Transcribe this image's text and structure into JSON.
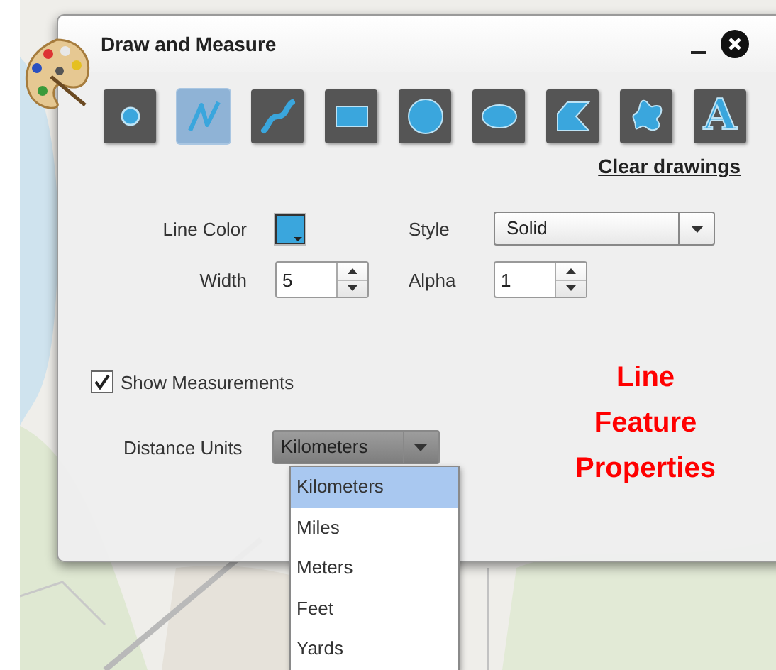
{
  "window": {
    "title": "Draw and Measure"
  },
  "tools": [
    {
      "kind": "point",
      "selected": false
    },
    {
      "kind": "polyline",
      "selected": true
    },
    {
      "kind": "freehand-line",
      "selected": false
    },
    {
      "kind": "rectangle",
      "selected": false
    },
    {
      "kind": "circle",
      "selected": false
    },
    {
      "kind": "ellipse",
      "selected": false
    },
    {
      "kind": "polygon",
      "selected": false
    },
    {
      "kind": "freehand-polygon",
      "selected": false
    },
    {
      "kind": "text",
      "glyph": "A",
      "selected": false
    }
  ],
  "clear_link": "Clear drawings",
  "line_color": {
    "label": "Line Color",
    "color": "#3aa6dd"
  },
  "style": {
    "label": "Style",
    "value": "Solid"
  },
  "width": {
    "label": "Width",
    "value": "5"
  },
  "alpha": {
    "label": "Alpha",
    "value": "1"
  },
  "show_measurements": {
    "label": "Show Measurements",
    "checked": true
  },
  "distance_units": {
    "label": "Distance Units",
    "value": "Kilometers",
    "expanded": true,
    "options": [
      {
        "label": "Kilometers",
        "selected": true
      },
      {
        "label": "Miles",
        "selected": false
      },
      {
        "label": "Meters",
        "selected": false
      },
      {
        "label": "Feet",
        "selected": false
      },
      {
        "label": "Yards",
        "selected": false
      }
    ]
  },
  "annotation": [
    "Line",
    "Feature",
    "Properties"
  ]
}
